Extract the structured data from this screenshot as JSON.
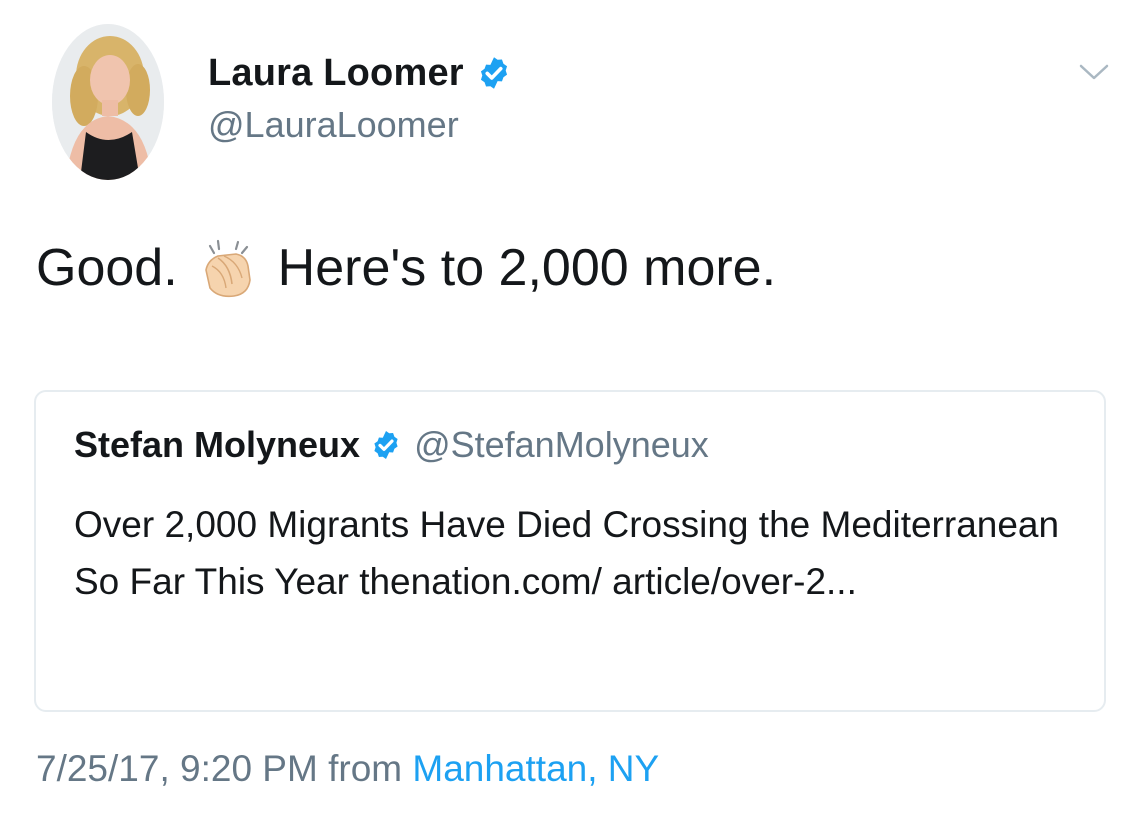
{
  "author": {
    "name": "Laura Loomer",
    "handle": "@LauraLoomer",
    "verified": true,
    "avatar_icon": "profile-photo"
  },
  "menu_icon": "chevron-down-icon",
  "tweet": {
    "text_before": "Good.",
    "emoji": "clapping-hands-icon",
    "text_after": "Here's to 2,000 more."
  },
  "quoted_tweet": {
    "name": "Stefan Molyneux",
    "handle": "@StefanMolyneux",
    "verified": true,
    "text": "Over 2,000 Migrants Have Died Crossing the Mediterranean So Far This Year  thenation.com/ article/over-2..."
  },
  "meta": {
    "timestamp": "7/25/17, 9:20 PM",
    "from_label": "from",
    "location": "Manhattan, NY"
  },
  "colors": {
    "text": "#14171a",
    "secondary": "#657786",
    "link": "#1da1f2",
    "verified": "#1da1f2",
    "border": "#e6ecf0"
  }
}
